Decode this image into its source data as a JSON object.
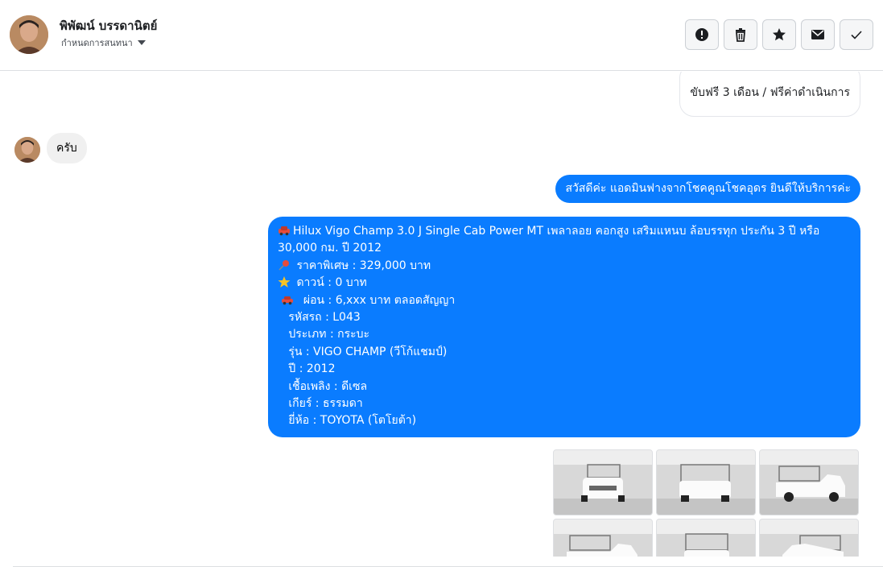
{
  "header": {
    "contact_name": "พิพัฒน์ บรรดานิตย์",
    "assign_label": "กำหนดการสนทนา",
    "actions": [
      {
        "name": "report-icon",
        "label": "report"
      },
      {
        "name": "trash-icon",
        "label": "delete"
      },
      {
        "name": "star-icon",
        "label": "star"
      },
      {
        "name": "mail-icon",
        "label": "mark unread"
      },
      {
        "name": "check-icon",
        "label": "done"
      }
    ]
  },
  "thread": {
    "prev_out_message": "ขับฟรี 3 เดือน / ฟรีค่าดำเนินการ",
    "in_message": "ครับ",
    "greeting_message": "สวัสดีค่ะ แอดมินฟางจากโชคคูณโชคอุดร ยินดีให้บริการค่ะ",
    "listing": {
      "title_line1": "Hilux Vigo Champ 3.0 J Single Cab Power MT เพลาลอย คอกสูง เสริมแหนบ ล้อบรรทุก ประกัน 3 ปี หรือ",
      "title_line2": "30,000 กม. ปี 2012",
      "price": " ราคาพิเศษ : 329,000 บาท",
      "down": " ดาวน์ : 0 บาท",
      "installment": "  ผ่อน : 6,xxx บาท ตลอดสัญญา",
      "code": "   รหัสรถ : L043",
      "type": "   ประเภท : กระบะ",
      "model": "   รุ่น : VIGO CHAMP (วีโก้แชมป์)",
      "year": "   ปี : 2012",
      "fuel": "   เชื้อเพลิง : ดีเซล",
      "gear": "   เกียร์ : ธรรมดา",
      "brand": "   ยี่ห้อ : TOYOTA (โตโยต้า)"
    },
    "photos_count": 6
  },
  "colors": {
    "accent_blue": "#0a7cff",
    "incoming_bg": "#f0f0f0"
  }
}
